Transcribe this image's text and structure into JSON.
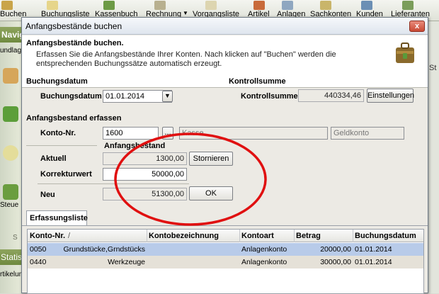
{
  "app": {
    "toolbar": [
      {
        "label": "Buchen",
        "icon": "book-icon"
      },
      {
        "label": "Buchungsliste",
        "icon": "list-icon"
      },
      {
        "label": "Kassenbuch",
        "icon": "cashbook-icon"
      },
      {
        "label": "Rechnung",
        "icon": "invoice-icon"
      },
      {
        "label": "Vorgangsliste",
        "icon": "document-icon"
      },
      {
        "label": "Artikel",
        "icon": "article-icon"
      },
      {
        "label": "Anlagen",
        "icon": "assets-icon"
      },
      {
        "label": "Sachkonten",
        "icon": "accounts-icon"
      },
      {
        "label": "Kunden",
        "icon": "customers-icon"
      },
      {
        "label": "Lieferanten",
        "icon": "suppliers-icon"
      }
    ],
    "sidebar": {
      "nav_title": "Navig",
      "item_top": "undlage",
      "item_bottom": "Steue",
      "stat_title": "Statis",
      "stat_item": "rtikelum",
      "left_fragment_1": "S",
      "left_fragment_2": "St"
    }
  },
  "dialog": {
    "title": "Anfangsbestände buchen",
    "close_label": "x",
    "header": {
      "title": "Anfangsbestände buchen.",
      "description": "Erfassen Sie die Anfangsbestände Ihrer Konten. Nach klicken auf \"Buchen\" werden die entsprechenden Buchungssätze automatisch erzeugt."
    },
    "buchungsdatum_group": "Buchungsdatum",
    "buchungsdatum_label": "Buchungsdatum",
    "buchungsdatum_value": "01.01.2014",
    "kontrollsumme_group": "Kontrollsumme",
    "kontrollsumme_label": "Kontrollsumme",
    "kontrollsumme_value": "440334,46",
    "einstellungen_button": "Einstellungen",
    "erfassen_group": "Anfangsbestand erfassen",
    "konto_label": "Konto-Nr.",
    "konto_value": "1600",
    "konto_lookup_button": "...",
    "konto_name": "Kasse",
    "konto_type": "Geldkonto",
    "anfangsbestand_label": "Anfangsbestand",
    "aktuell_label": "Aktuell",
    "aktuell_value": "1300,00",
    "stornieren_button": "Stornieren",
    "korrektur_label": "Korrekturwert",
    "korrektur_value": "50000,00",
    "neu_label": "Neu",
    "neu_value": "51300,00",
    "ok_button": "OK",
    "tab_label": "Erfassungsliste",
    "grid": {
      "columns": [
        "Konto-Nr.",
        "/",
        "Kontobezeichnung",
        "Kontoart",
        "Betrag",
        "Buchungsdatum"
      ],
      "rows": [
        {
          "konto": "0050",
          "bezeichnung": "Grundstücke,Grndstücks",
          "art": "Anlagenkonto",
          "betrag": "20000,00",
          "datum": "01.01.2014"
        },
        {
          "konto": "0440",
          "bezeichnung": "Werkzeuge",
          "art": "Anlagenkonto",
          "betrag": "30000,00",
          "datum": "01.01.2014"
        }
      ]
    }
  },
  "colors": {
    "selected_row": "#b8cbe9",
    "second_row": "#e5e1d8",
    "annotation_red": "#e01010"
  }
}
